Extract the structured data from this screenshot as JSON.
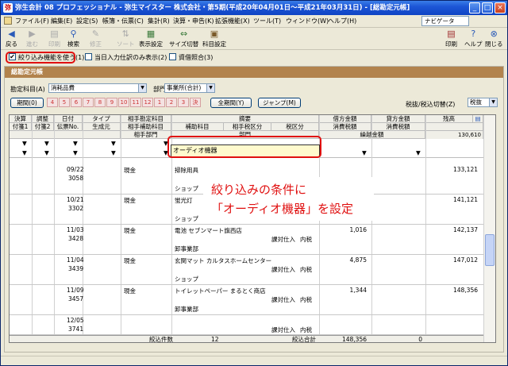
{
  "title": "弥生会計 08 プロフェッショナル - 弥生マイスター 株式会社・第5期(平成20年04月01日～平成21年03月31日) - [総勘定元帳]",
  "menu": [
    "ファイル(F)",
    "編集(E)",
    "設定(S)",
    "帳簿・伝票(C)",
    "集計(R)",
    "決算・申告(K)",
    "拡張機能(X)",
    "ツール(T)",
    "ウィンドウ(W)",
    "ヘルプ(H)"
  ],
  "navi": "ナビゲータ",
  "toolbar": {
    "left": [
      "戻る",
      "進む",
      "印刷",
      "検索",
      "修正",
      "ソート",
      "表示設定",
      "サイズ切替",
      "科目設定"
    ],
    "right": [
      "印刷",
      "ヘルプ",
      "閉じる"
    ]
  },
  "filters": {
    "narrow": "絞り込み機能を使う(1)",
    "today": "当日入力仕訳のみ表示(2)",
    "ledger": "資借照合(3)"
  },
  "panel": {
    "header": "総勘定元帳",
    "account_label": "勘定科目(A)",
    "account_value": "消耗品費",
    "dept_label": "部門(B)",
    "dept_value": "事業所(合計)",
    "period_btn": "期間(0)",
    "months": [
      "4",
      "5",
      "6",
      "7",
      "8",
      "9",
      "10",
      "11",
      "12",
      "1",
      "2",
      "3",
      "決"
    ],
    "all_period": "全期間(Y)",
    "jump": "ジャンプ(M)",
    "tax_label": "税抜/税込切替(Z)",
    "tax_value": "税抜"
  },
  "columns": {
    "row1": [
      "決算",
      "調整",
      "日付",
      "タイプ",
      "相手勘定科目",
      "摘要",
      "借方金額",
      "貸方金額",
      "残高"
    ],
    "row2": [
      "付箋1",
      "付箋2",
      "伝票No.",
      "生成元",
      "相手補助科目",
      "補助科目",
      "相手税区分",
      "税区分",
      "消費税額",
      "消費税額"
    ],
    "row3": [
      "相手部門",
      "部門",
      "繰越金額"
    ]
  },
  "filter_value": "オーディオ機器",
  "carry": "130,610",
  "rows": [
    {
      "date": "09/22",
      "no": "3058",
      "acct": "現金",
      "memo": "掃除用具",
      "dept": "ショップ",
      "tax": "",
      "taxcls": "",
      "debit": "",
      "bal": "133,121"
    },
    {
      "date": "10/21",
      "no": "3302",
      "acct": "現金",
      "memo": "蛍光灯",
      "dept": "ショップ",
      "tax": "",
      "taxcls": "",
      "debit": "",
      "bal": "141,121"
    },
    {
      "date": "11/03",
      "no": "3428",
      "acct": "現金",
      "memo": "電池 セブンマート旗西店",
      "dept": "卸事業部",
      "tax": "課対仕入",
      "taxcls": "内税",
      "debit": "1,016",
      "bal": "142,137"
    },
    {
      "date": "11/04",
      "no": "3439",
      "acct": "現金",
      "memo": "玄関マット カルタスホームセンター",
      "dept": "ショップ",
      "tax": "課対仕入",
      "taxcls": "内税",
      "debit": "4,875",
      "bal": "147,012"
    },
    {
      "date": "11/09",
      "no": "3457",
      "acct": "現金",
      "memo": "トイレットペーパー まるとく商店",
      "dept": "卸事業部",
      "tax": "課対仕入",
      "taxcls": "内税",
      "debit": "1,344",
      "bal": "148,356"
    },
    {
      "date": "12/05",
      "no": "3741",
      "acct": "",
      "memo": "",
      "dept": "",
      "tax": "課対仕入",
      "taxcls": "内税",
      "debit": "",
      "bal": ""
    }
  ],
  "footer": {
    "count_label": "絞込件数",
    "count": "12",
    "sum_label": "絞込合計",
    "debit_sum": "148,356",
    "credit_sum": "0"
  },
  "annotation": {
    "line1": "絞り込みの条件に",
    "line2": "「オーディオ機器」を設定"
  }
}
